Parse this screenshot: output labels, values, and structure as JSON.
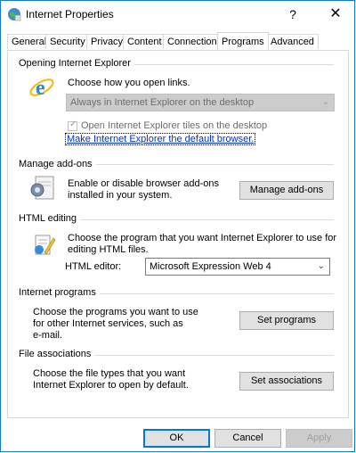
{
  "window": {
    "title": "Internet Properties",
    "help_glyph": "?",
    "close_glyph": "✕"
  },
  "tabs": [
    {
      "label": "General"
    },
    {
      "label": "Security"
    },
    {
      "label": "Privacy"
    },
    {
      "label": "Content"
    },
    {
      "label": "Connections"
    },
    {
      "label": "Programs"
    },
    {
      "label": "Advanced"
    }
  ],
  "active_tab": "Programs",
  "opening_ie": {
    "heading": "Opening Internet Explorer",
    "prompt": "Choose how you open links.",
    "select_value": "Always in Internet Explorer on the desktop",
    "checkbox_label": "Open Internet Explorer tiles on the desktop",
    "checkbox_checked": true,
    "default_link": "Make Internet Explorer the default browser."
  },
  "addons": {
    "heading": "Manage add-ons",
    "description_line1": "Enable or disable browser add-ons",
    "description_line2": "installed in your system.",
    "button": "Manage add-ons"
  },
  "html_editing": {
    "heading": "HTML editing",
    "description_line1": "Choose the program that you want Internet Explorer to use for",
    "description_line2": "editing HTML files.",
    "editor_label": "HTML editor:",
    "editor_value": "Microsoft Expression Web 4"
  },
  "internet_programs": {
    "heading": "Internet programs",
    "description_line1": "Choose the programs you want to use",
    "description_line2": "for other Internet services, such as",
    "description_line3": "e-mail.",
    "button": "Set programs"
  },
  "file_assoc": {
    "heading": "File associations",
    "description_line1": "Choose the file types that you want",
    "description_line2": "Internet Explorer to open by default.",
    "button": "Set associations"
  },
  "footer": {
    "ok": "OK",
    "cancel": "Cancel",
    "apply": "Apply"
  },
  "colors": {
    "link": "#0033cc",
    "accent": "#0078d7"
  }
}
